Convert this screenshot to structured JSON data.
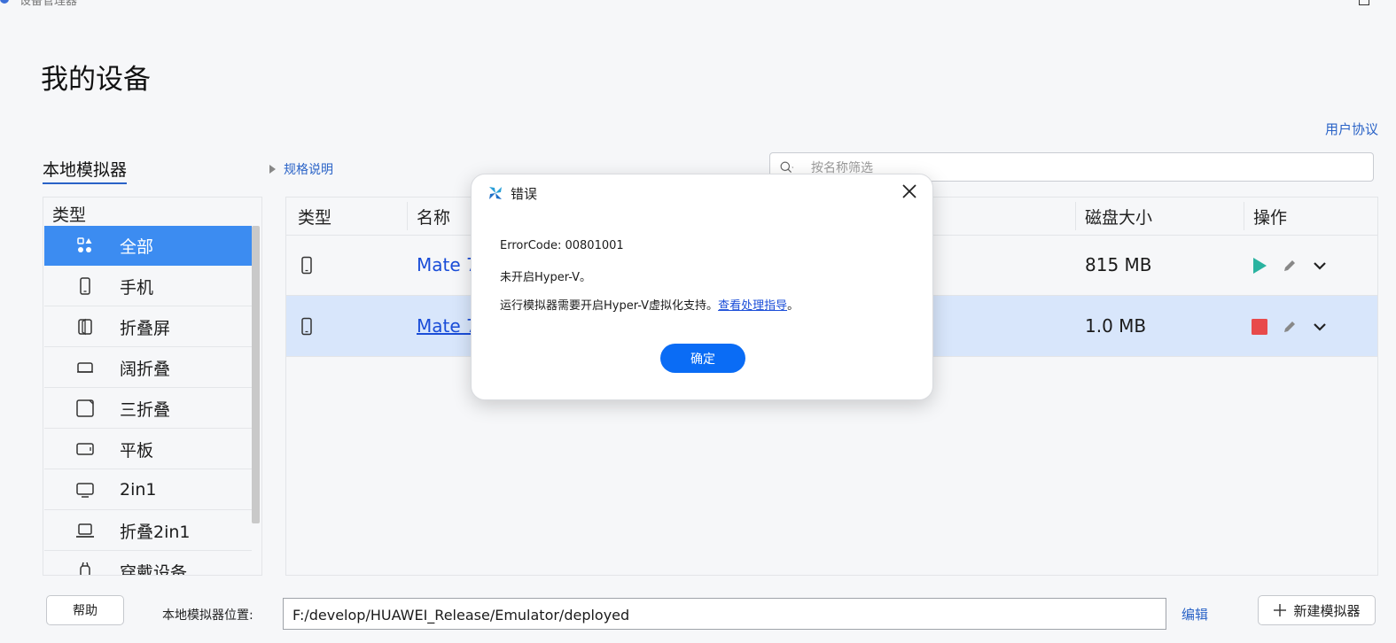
{
  "window": {
    "title": "设备管理器"
  },
  "page_title": "我的设备",
  "user_agreement": "用户协议",
  "tab_local": "本地模拟器",
  "spec_toggle": "规格说明",
  "search": {
    "placeholder": "按名称筛选",
    "value": ""
  },
  "type_panel": {
    "header": "类型",
    "items": [
      {
        "label": "全部",
        "icon": "grid-shapes-icon",
        "selected": true
      },
      {
        "label": "手机",
        "icon": "phone-icon"
      },
      {
        "label": "折叠屏",
        "icon": "foldable-icon"
      },
      {
        "label": "阔折叠",
        "icon": "wide-fold-icon"
      },
      {
        "label": "三折叠",
        "icon": "tri-fold-icon"
      },
      {
        "label": "平板",
        "icon": "tablet-icon"
      },
      {
        "label": "2in1",
        "icon": "monitor-icon"
      },
      {
        "label": "折叠2in1",
        "icon": "laptop-icon"
      },
      {
        "label": "穿戴设备",
        "icon": "watch-icon"
      }
    ]
  },
  "table": {
    "headers": {
      "type": "类型",
      "name": "名称",
      "disk": "磁盘大小",
      "actions": "操作"
    },
    "rows": [
      {
        "name": "Mate 7",
        "disk": "815 MB",
        "running": false,
        "selected": false
      },
      {
        "name": "Mate 7",
        "disk": "1.0 MB",
        "running": true,
        "selected": true
      }
    ]
  },
  "bottom": {
    "help": "帮助",
    "location_label": "本地模拟器位置:",
    "location_value": "F:/develop/HUAWEI_Release/Emulator/deployed",
    "edit": "编辑",
    "new_emulator": "新建模拟器"
  },
  "dialog": {
    "title": "错误",
    "error_code": "ErrorCode: 00801001",
    "message1": "未开启Hyper-V。",
    "message2_prefix": "运行模拟器需要开启Hyper-V虚拟化支持。",
    "message2_link": "查看处理指导",
    "message2_suffix": "。",
    "ok": "确定"
  },
  "colors": {
    "accent": "#0a6cf5",
    "link": "#2a63c7",
    "selected_type": "#3c8cf1",
    "selected_row": "#d8e6fb",
    "play": "#2ab3a0",
    "stop": "#e84a4a"
  }
}
